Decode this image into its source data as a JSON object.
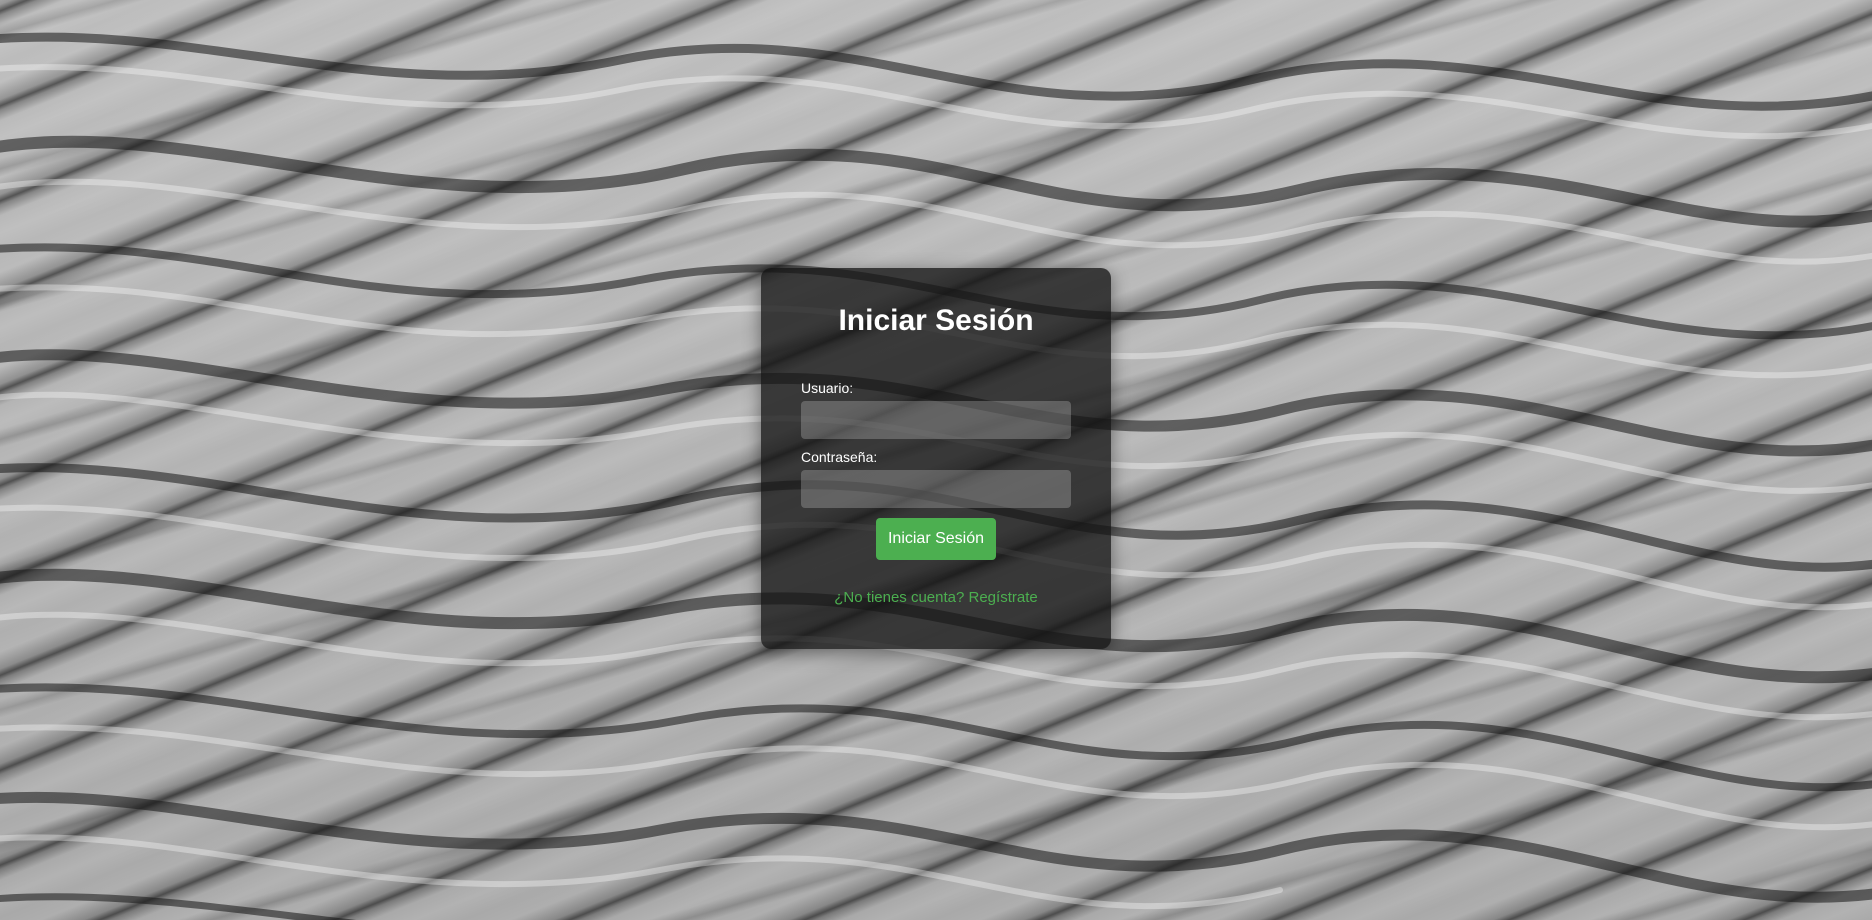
{
  "login": {
    "title": "Iniciar Sesión",
    "username_label": "Usuario:",
    "username_value": "",
    "password_label": "Contraseña:",
    "password_value": "",
    "submit_label": "Iniciar Sesión",
    "register_link": "¿No tienes cuenta? Regístrate"
  },
  "colors": {
    "accent": "#4caf50",
    "card_background": "#141414",
    "text": "#ffffff"
  },
  "background": {
    "image": "sand-dunes-texture"
  }
}
